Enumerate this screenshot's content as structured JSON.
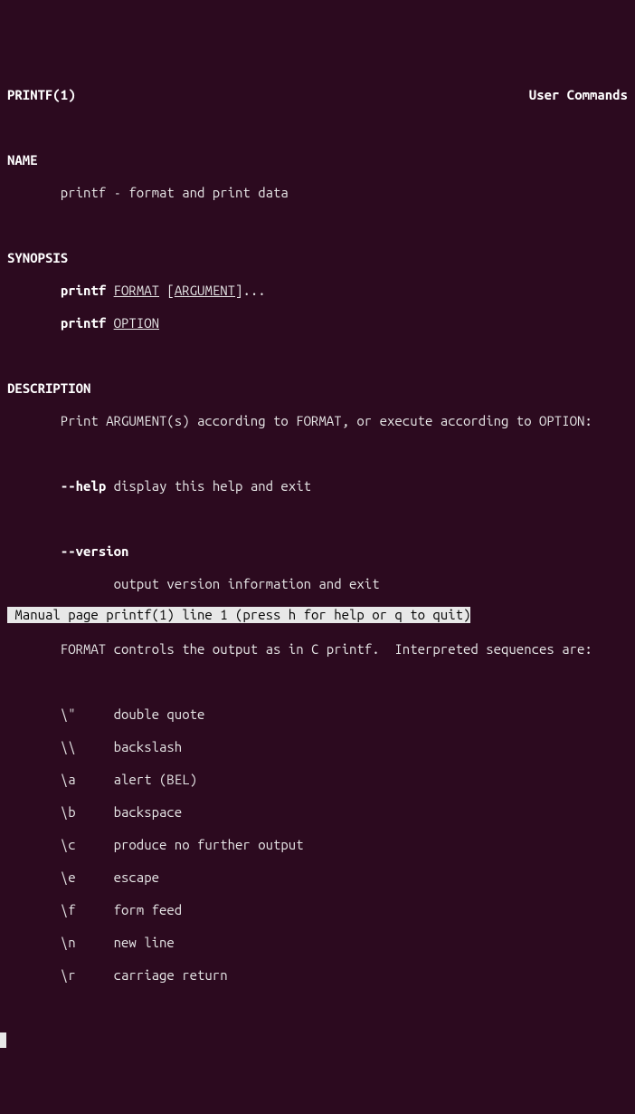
{
  "header": {
    "left": "PRINTF(1)",
    "right": "User Commands"
  },
  "sections": {
    "name_h": "NAME",
    "name_body": "       printf - format and print data",
    "syn_h": "SYNOPSIS",
    "syn_cmd1": "printf",
    "syn_fmt": "FORMAT",
    "syn_sp": " [",
    "syn_arg": "ARGUMENT",
    "syn_tail": "]...",
    "syn_cmd2": "printf",
    "syn_opt": "OPTION",
    "desc_h": "DESCRIPTION",
    "desc1": "       Print ARGUMENT(s) according to FORMAT, or execute according to OPTION:",
    "help_flag": "--help",
    "help_txt": " display this help and exit",
    "ver_flag": "--version",
    "ver_txt": "              output version information and exit",
    "fmt_line": "       FORMAT controls the output as in C printf.  Interpreted sequences are:",
    "seq": [
      {
        "k": "\\\"",
        "v": "double quote"
      },
      {
        "k": "\\\\",
        "v": "backslash"
      },
      {
        "k": "\\a",
        "v": "alert (BEL)"
      },
      {
        "k": "\\b",
        "v": "backspace"
      },
      {
        "k": "\\c",
        "v": "produce no further output"
      },
      {
        "k": "\\e",
        "v": "escape"
      },
      {
        "k": "\\f",
        "v": "form feed"
      },
      {
        "k": "\\n",
        "v": "new line"
      },
      {
        "k": "\\r",
        "v": "carriage return"
      }
    ]
  },
  "status": " Manual page printf(1) line 1 (press h for help or q to quit)"
}
